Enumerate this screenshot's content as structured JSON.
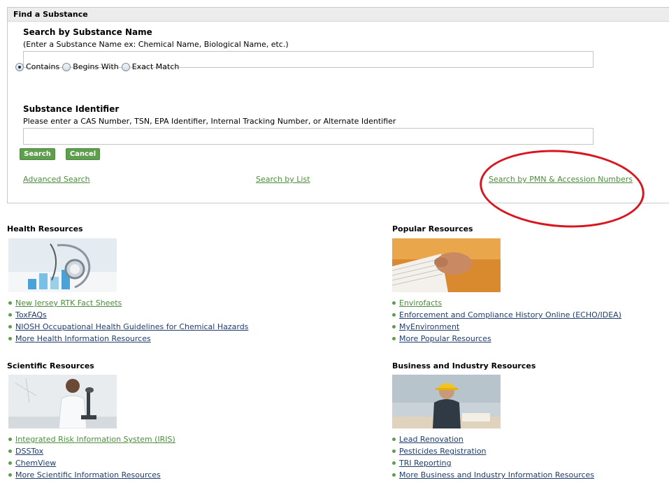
{
  "search_panel": {
    "title": "Find a Substance",
    "name_heading": "Search by Substance Name",
    "name_hint": "(Enter a Substance Name ex: Chemical Name, Biological Name, etc.)",
    "name_value": "",
    "match_options": [
      {
        "label": "Contains",
        "selected": true
      },
      {
        "label": "Begins With",
        "selected": false
      },
      {
        "label": "Exact Match",
        "selected": false
      }
    ],
    "id_heading": "Substance Identifier",
    "id_hint": "Please enter a CAS Number, TSN, EPA Identifier, Internal Tracking Number, or Alternate Identifier",
    "id_value": "",
    "search_button": "Search",
    "cancel_button": "Cancel",
    "links": {
      "advanced": "Advanced Search",
      "by_list": "Search by List",
      "by_pmn": "Search by PMN & Accession Numbers"
    }
  },
  "annotation": {
    "color": "#d8161e"
  },
  "colors": {
    "link_green": "#4b8c3a",
    "link_navy": "#1f3d6e",
    "button_green": "#5f9e4e"
  },
  "sections": {
    "health": {
      "title": "Health Resources",
      "links": [
        {
          "label": "New Jersey RTK Fact Sheets"
        },
        {
          "label": "ToxFAQs"
        },
        {
          "label": "NIOSH Occupational Health Guidelines for Chemical Hazards"
        },
        {
          "label": "More Health Information Resources"
        }
      ]
    },
    "popular": {
      "title": "Popular Resources",
      "links": [
        {
          "label": "Envirofacts"
        },
        {
          "label": "Enforcement and Compliance History Online (ECHO/IDEA)"
        },
        {
          "label": "MyEnvironment"
        },
        {
          "label": "More Popular Resources"
        }
      ]
    },
    "scientific": {
      "title": "Scientific Resources",
      "links": [
        {
          "label": "Integrated Risk Information System (IRIS)"
        },
        {
          "label": "DSSTox"
        },
        {
          "label": "ChemView"
        },
        {
          "label": "More Scientific Information Resources"
        }
      ]
    },
    "business": {
      "title": "Business and Industry Resources",
      "links": [
        {
          "label": "Lead Renovation"
        },
        {
          "label": "Pesticides Registration"
        },
        {
          "label": "TRI Reporting"
        },
        {
          "label": "More Business and Industry Information Resources"
        }
      ]
    }
  }
}
